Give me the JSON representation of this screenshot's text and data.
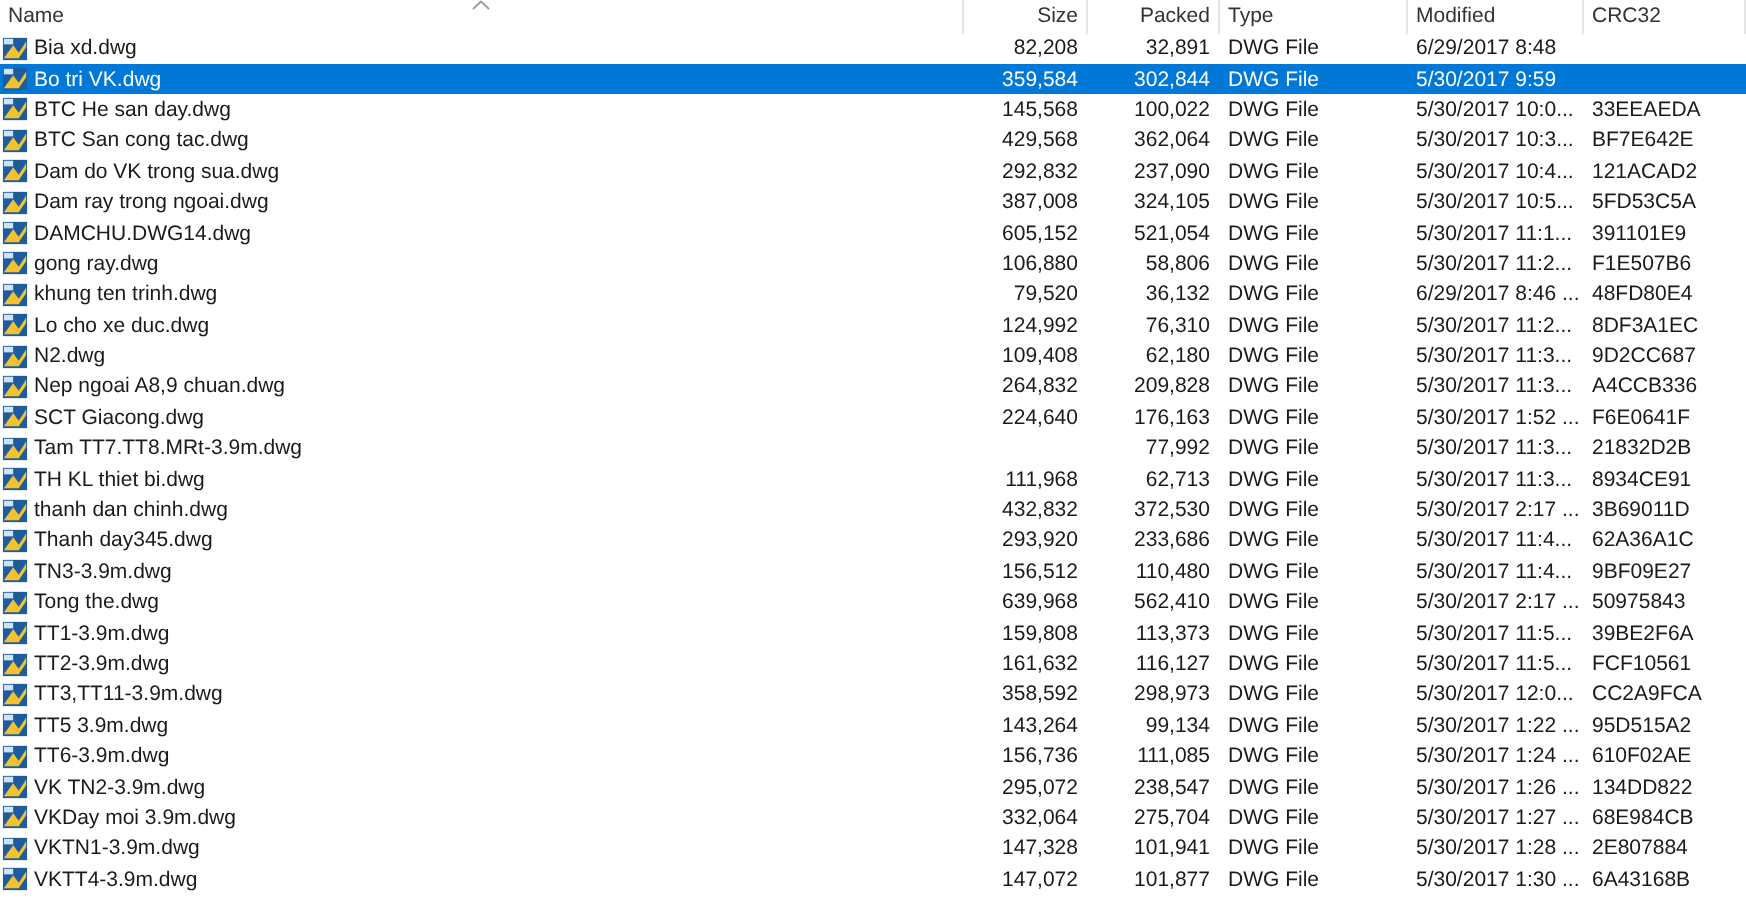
{
  "columns": [
    {
      "label": "Name",
      "sorted": true
    },
    {
      "label": "Size",
      "sorted": false
    },
    {
      "label": "Packed",
      "sorted": false
    },
    {
      "label": "Type",
      "sorted": false
    },
    {
      "label": "Modified",
      "sorted": false
    },
    {
      "label": "CRC32",
      "sorted": false
    }
  ],
  "rows": [
    {
      "name": "Bia xd.dwg",
      "size": "82,208",
      "packed": "32,891",
      "type": "DWG File",
      "modified": "6/29/2017 8:48",
      "selected": false
    },
    {
      "name": "Bo tri VK.dwg",
      "size": "359,584",
      "packed": "302,844",
      "type": "DWG File",
      "modified": "5/30/2017 9:59",
      "selected": true
    },
    {
      "name": "BTC He san day.dwg",
      "size": "145,568",
      "packed": "100,022",
      "type": "DWG File",
      "modified": "5/30/2017 10:0...",
      "crc": "33EEAEDA",
      "selected": false
    },
    {
      "name": "BTC San cong tac.dwg",
      "size": "429,568",
      "packed": "362,064",
      "type": "DWG File",
      "modified": "5/30/2017 10:3...",
      "crc": "BF7E642E",
      "selected": false
    },
    {
      "name": "Dam do VK trong sua.dwg",
      "size": "292,832",
      "packed": "237,090",
      "type": "DWG File",
      "modified": "5/30/2017 10:4...",
      "crc": "121ACAD2",
      "selected": false
    },
    {
      "name": "Dam ray trong ngoai.dwg",
      "size": "387,008",
      "packed": "324,105",
      "type": "DWG File",
      "modified": "5/30/2017 10:5...",
      "crc": "5FD53C5A",
      "selected": false
    },
    {
      "name": "DAMCHU.DWG14.dwg",
      "size": "605,152",
      "packed": "521,054",
      "type": "DWG File",
      "modified": "5/30/2017 11:1...",
      "crc": "391101E9",
      "selected": false
    },
    {
      "name": "gong ray.dwg",
      "size": "106,880",
      "packed": "58,806",
      "type": "DWG File",
      "modified": "5/30/2017 11:2...",
      "crc": "F1E507B6",
      "selected": false
    },
    {
      "name": "khung ten trinh.dwg",
      "size": "79,520",
      "packed": "36,132",
      "type": "DWG File",
      "modified": "6/29/2017 8:46 ...",
      "crc": "48FD80E4",
      "selected": false
    },
    {
      "name": "Lo cho xe duc.dwg",
      "size": "124,992",
      "packed": "76,310",
      "type": "DWG File",
      "modified": "5/30/2017 11:2...",
      "crc": "8DF3A1EC",
      "selected": false
    },
    {
      "name": "N2.dwg",
      "size": "109,408",
      "packed": "62,180",
      "type": "DWG File",
      "modified": "5/30/2017 11:3...",
      "crc": "9D2CC687",
      "selected": false
    },
    {
      "name": "Nep ngoai A8,9 chuan.dwg",
      "size": "264,832",
      "packed": "209,828",
      "type": "DWG File",
      "modified": "5/30/2017 11:3...",
      "crc": "A4CCB336",
      "selected": false
    },
    {
      "name": "SCT Giacong.dwg",
      "size": "224,640",
      "packed": "176,163",
      "type": "DWG File",
      "modified": "5/30/2017 1:52 ...",
      "crc": "F6E0641F",
      "selected": false
    },
    {
      "name": "Tam TT7.TT8.MRt-3.9m.dwg",
      "packed": "77,992",
      "type": "DWG File",
      "modified": "5/30/2017 11:3...",
      "crc": "21832D2B",
      "selected": false
    },
    {
      "name": "TH KL thiet bi.dwg",
      "size": "111,968",
      "packed": "62,713",
      "type": "DWG File",
      "modified": "5/30/2017 11:3...",
      "crc": "8934CE91",
      "selected": false
    },
    {
      "name": "thanh dan chinh.dwg",
      "size": "432,832",
      "packed": "372,530",
      "type": "DWG File",
      "modified": "5/30/2017 2:17 ...",
      "crc": "3B69011D",
      "selected": false
    },
    {
      "name": "Thanh day345.dwg",
      "size": "293,920",
      "packed": "233,686",
      "type": "DWG File",
      "modified": "5/30/2017 11:4...",
      "crc": "62A36A1C",
      "selected": false
    },
    {
      "name": "TN3-3.9m.dwg",
      "size": "156,512",
      "packed": "110,480",
      "type": "DWG File",
      "modified": "5/30/2017 11:4...",
      "crc": "9BF09E27",
      "selected": false
    },
    {
      "name": "Tong the.dwg",
      "size": "639,968",
      "packed": "562,410",
      "type": "DWG File",
      "modified": "5/30/2017 2:17 ...",
      "crc": "50975843",
      "selected": false
    },
    {
      "name": "TT1-3.9m.dwg",
      "size": "159,808",
      "packed": "113,373",
      "type": "DWG File",
      "modified": "5/30/2017 11:5...",
      "crc": "39BE2F6A",
      "selected": false
    },
    {
      "name": "TT2-3.9m.dwg",
      "size": "161,632",
      "packed": "116,127",
      "type": "DWG File",
      "modified": "5/30/2017 11:5...",
      "crc": "FCF10561",
      "selected": false
    },
    {
      "name": "TT3,TT11-3.9m.dwg",
      "size": "358,592",
      "packed": "298,973",
      "type": "DWG File",
      "modified": "5/30/2017 12:0...",
      "crc": "CC2A9FCA",
      "selected": false
    },
    {
      "name": "TT5 3.9m.dwg",
      "size": "143,264",
      "packed": "99,134",
      "type": "DWG File",
      "modified": "5/30/2017 1:22 ...",
      "crc": "95D515A2",
      "selected": false
    },
    {
      "name": "TT6-3.9m.dwg",
      "size": "156,736",
      "packed": "111,085",
      "type": "DWG File",
      "modified": "5/30/2017 1:24 ...",
      "crc": "610F02AE",
      "selected": false
    },
    {
      "name": "VK TN2-3.9m.dwg",
      "size": "295,072",
      "packed": "238,547",
      "type": "DWG File",
      "modified": "5/30/2017 1:26 ...",
      "crc": "134DD822",
      "selected": false
    },
    {
      "name": "VKDay moi 3.9m.dwg",
      "size": "332,064",
      "packed": "275,704",
      "type": "DWG File",
      "modified": "5/30/2017 1:27 ...",
      "crc": "68E984CB",
      "selected": false
    },
    {
      "name": "VKTN1-3.9m.dwg",
      "size": "147,328",
      "packed": "101,941",
      "type": "DWG File",
      "modified": "5/30/2017 1:28 ...",
      "crc": "2E807884",
      "selected": false
    },
    {
      "name": "VKTT4-3.9m.dwg",
      "size": "147,072",
      "packed": "101,877",
      "type": "DWG File",
      "modified": "5/30/2017 1:30 ...",
      "crc": "6A43168B",
      "selected": false
    }
  ]
}
